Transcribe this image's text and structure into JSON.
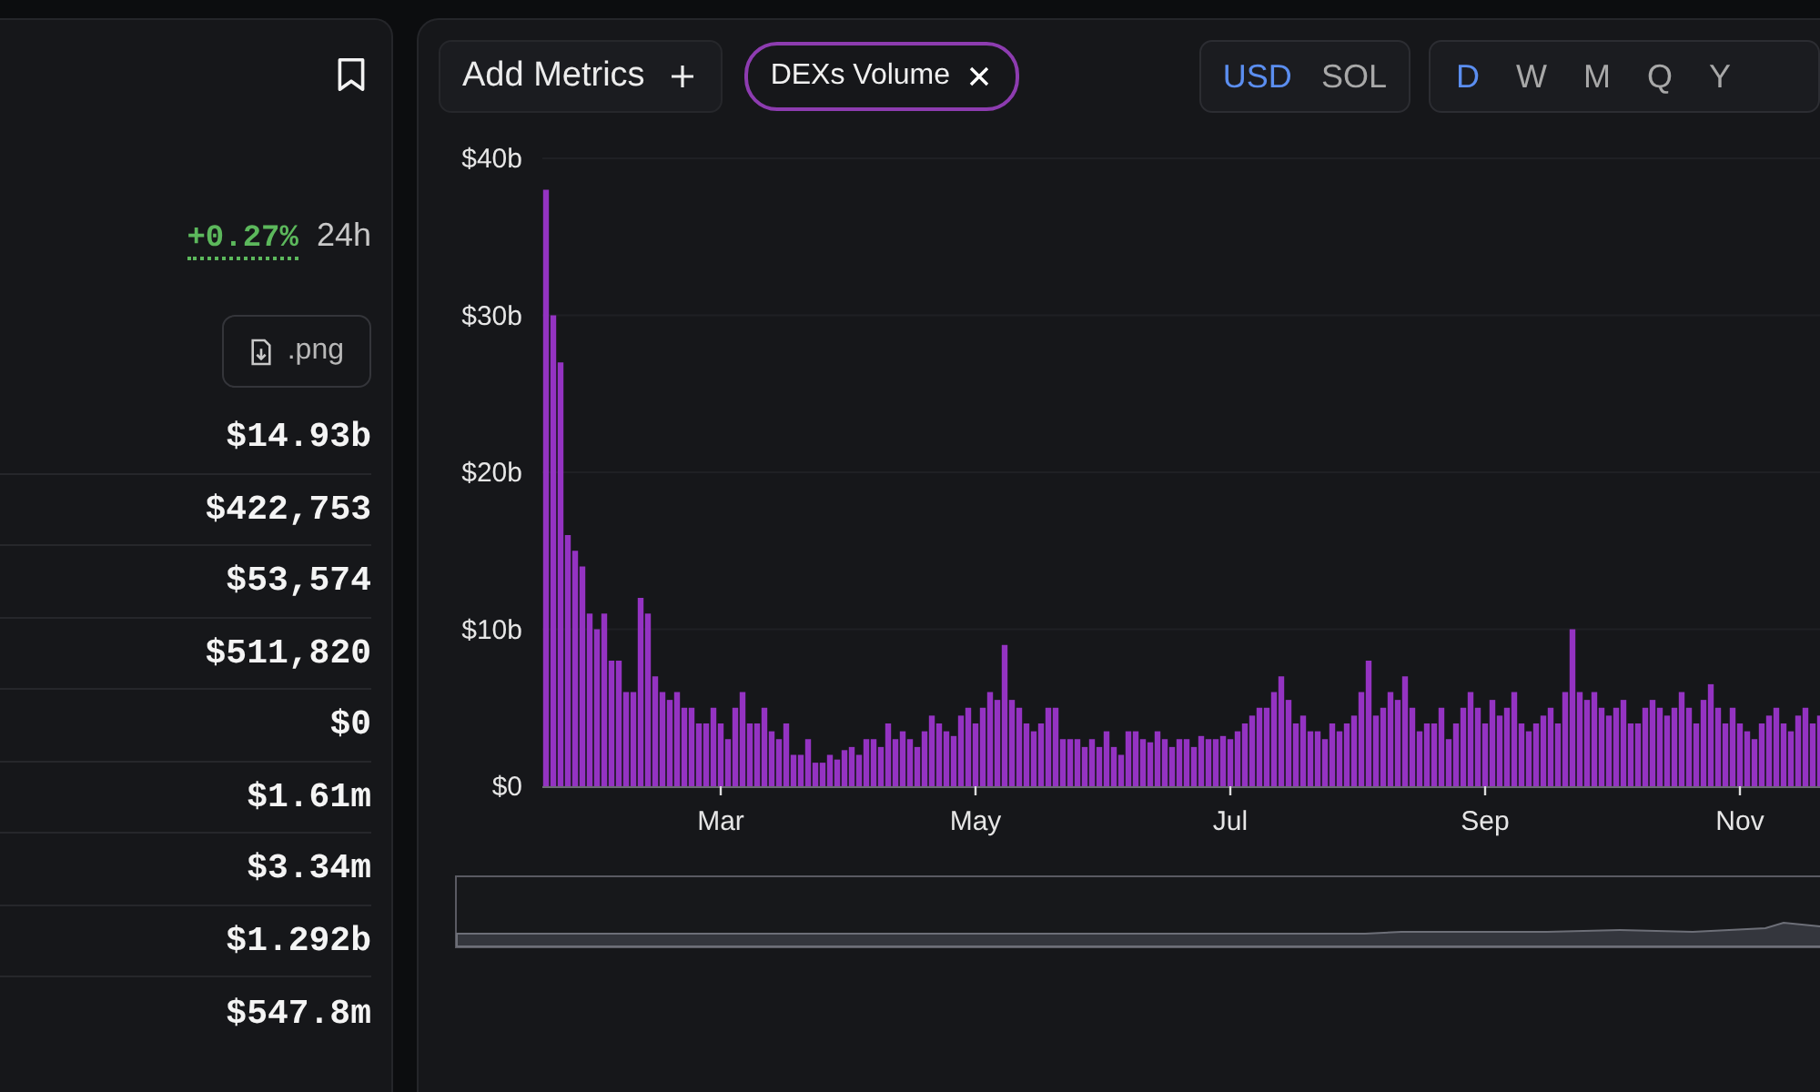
{
  "left_panel": {
    "change": {
      "value": "+0.27%",
      "period": "24h"
    },
    "export_button": ".png",
    "stats": [
      "$14.93b",
      "$422,753",
      "$53,574",
      "$511,820",
      "$0",
      "$1.61m",
      "$3.34m",
      "$1.292b",
      "$547.8m"
    ]
  },
  "toolbar": {
    "add_metrics": "Add Metrics",
    "metric_chips": [
      {
        "label": "DEXs Volume"
      }
    ],
    "currency_options": [
      {
        "label": "USD",
        "selected": true
      },
      {
        "label": "SOL",
        "selected": false
      }
    ],
    "interval_options": [
      {
        "label": "D",
        "selected": true
      },
      {
        "label": "W",
        "selected": false
      },
      {
        "label": "M",
        "selected": false
      },
      {
        "label": "Q",
        "selected": false
      },
      {
        "label": "Y",
        "selected": false
      }
    ]
  },
  "chart": {
    "range_slider": {
      "level": 1
    },
    "chart_data": {
      "type": "bar",
      "ylim": [
        0,
        40
      ],
      "grid": true,
      "yticks": [
        {
          "value": 0,
          "label": "$0"
        },
        {
          "value": 10,
          "label": "$10b"
        },
        {
          "value": 20,
          "label": "$20b"
        },
        {
          "value": 30,
          "label": "$30b"
        },
        {
          "value": 40,
          "label": "$40b"
        }
      ],
      "categories": [
        null,
        null,
        null,
        null,
        null,
        null,
        null,
        null,
        null,
        null,
        null,
        null,
        null,
        null,
        null,
        null,
        null,
        null,
        null,
        null,
        null,
        null,
        null,
        null,
        "Mar",
        null,
        null,
        null,
        null,
        null,
        null,
        null,
        null,
        null,
        null,
        null,
        null,
        null,
        null,
        null,
        null,
        null,
        null,
        null,
        null,
        null,
        null,
        null,
        null,
        null,
        null,
        null,
        null,
        null,
        null,
        null,
        null,
        null,
        null,
        "May",
        null,
        null,
        null,
        null,
        null,
        null,
        null,
        null,
        null,
        null,
        null,
        null,
        null,
        null,
        null,
        null,
        null,
        null,
        null,
        null,
        null,
        null,
        null,
        null,
        null,
        null,
        null,
        null,
        null,
        null,
        null,
        null,
        null,
        null,
        "Jul",
        null,
        null,
        null,
        null,
        null,
        null,
        null,
        null,
        null,
        null,
        null,
        null,
        null,
        null,
        null,
        null,
        null,
        null,
        null,
        null,
        null,
        null,
        null,
        null,
        null,
        null,
        null,
        null,
        null,
        null,
        null,
        null,
        null,
        null,
        "Sep",
        null,
        null,
        null,
        null,
        null,
        null,
        null,
        null,
        null,
        null,
        null,
        null,
        null,
        null,
        null,
        null,
        null,
        null,
        null,
        null,
        null,
        null,
        null,
        null,
        null,
        null,
        null,
        null,
        null,
        null,
        null,
        null,
        null,
        null,
        "Nov",
        null,
        null,
        null,
        null,
        null,
        null,
        null,
        null,
        null,
        null,
        null
      ],
      "series": [
        {
          "color": "#9433c2",
          "values": [
            38,
            30,
            27,
            16,
            15,
            14,
            11,
            10,
            11,
            8,
            8,
            6,
            6,
            12,
            11,
            7,
            6,
            5.5,
            6,
            5,
            5,
            4,
            4,
            5,
            4,
            3,
            5,
            6,
            4,
            4,
            5,
            3.5,
            3,
            4,
            2,
            2,
            3,
            1.5,
            1.5,
            2,
            1.7,
            2.3,
            2.5,
            2,
            3,
            3,
            2.5,
            4,
            3,
            3.5,
            3,
            2.5,
            3.5,
            4.5,
            4,
            3.5,
            3.2,
            4.5,
            5,
            4,
            5,
            6,
            5.5,
            9,
            5.5,
            5,
            4,
            3.5,
            4,
            5,
            5,
            3,
            3,
            3,
            2.5,
            3,
            2.5,
            3.5,
            2.5,
            2,
            3.5,
            3.5,
            3,
            2.8,
            3.5,
            3,
            2.5,
            3,
            3,
            2.5,
            3.2,
            3,
            3,
            3.2,
            3,
            3.5,
            4,
            4.5,
            5,
            5,
            6,
            7,
            5.5,
            4,
            4.5,
            3.5,
            3.5,
            3,
            4,
            3.5,
            4,
            4.5,
            6,
            8,
            4.5,
            5,
            6,
            5.5,
            7,
            5,
            3.5,
            4,
            4,
            5,
            3,
            4,
            5,
            6,
            5,
            4,
            5.5,
            4.5,
            5,
            6,
            4,
            3.5,
            4,
            4.5,
            5,
            4,
            6,
            10,
            6,
            5.5,
            6,
            5,
            4.5,
            5,
            5.5,
            4,
            4,
            5,
            5.5,
            5,
            4.5,
            5,
            6,
            5,
            4,
            5.5,
            6.5,
            5,
            4,
            5,
            4,
            3.5,
            3,
            4,
            4.5,
            5,
            4,
            3.5,
            4.5,
            5,
            4,
            4.5
          ]
        }
      ]
    }
  }
}
